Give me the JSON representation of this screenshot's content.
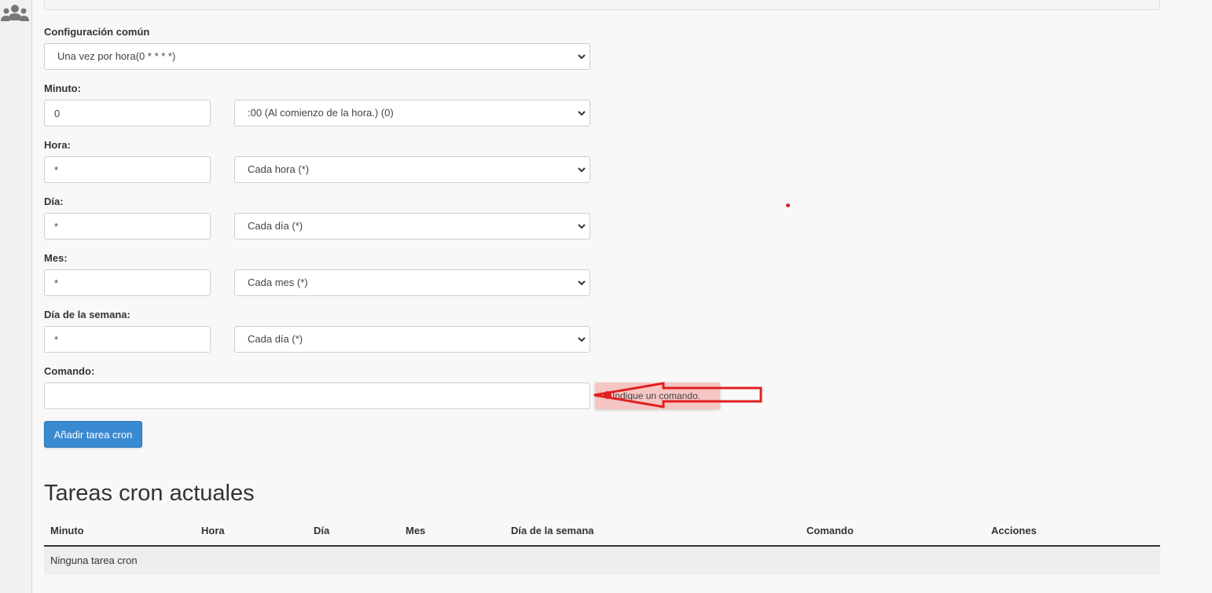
{
  "form": {
    "common": {
      "label": "Configuración común",
      "value": "Una vez por hora(0 * * * *)"
    },
    "minute": {
      "label": "Minuto:",
      "value": "0",
      "select": ":00 (Al comienzo de la hora.) (0)"
    },
    "hour": {
      "label": "Hora:",
      "value": "*",
      "select": "Cada hora (*)"
    },
    "day": {
      "label": "Día:",
      "value": "*",
      "select": "Cada día (*)"
    },
    "month": {
      "label": "Mes:",
      "value": "*",
      "select": "Cada mes (*)"
    },
    "weekday": {
      "label": "Día de la semana:",
      "value": "*",
      "select": "Cada día (*)"
    },
    "command": {
      "label": "Comando:",
      "value": "",
      "tooltip": "Indique un comando."
    },
    "submit_label": "Añadir tarea cron"
  },
  "table": {
    "heading": "Tareas cron actuales",
    "columns": [
      "Minuto",
      "Hora",
      "Día",
      "Mes",
      "Día de la semana",
      "Comando",
      "Acciones"
    ],
    "empty_text": "Ninguna tarea cron"
  },
  "colors": {
    "primary_button": "#3a8ad2",
    "annotation_red": "#e02020",
    "tooltip_bg": "#f6c6c4"
  },
  "icons": {
    "sidebar": "users-icon",
    "select": "chevron-down-icon"
  }
}
